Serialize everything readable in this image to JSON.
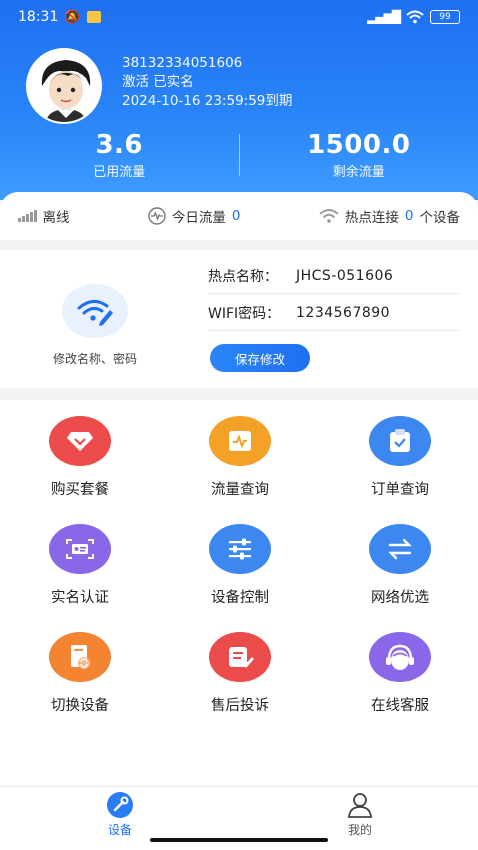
{
  "status_bar": {
    "time": "18:31",
    "battery": "99"
  },
  "profile": {
    "id": "38132334051606",
    "status": "激活  已实名",
    "expiry": "2024-10-16 23:59:59到期"
  },
  "stats": [
    {
      "value": "3.6",
      "label": "已用流量"
    },
    {
      "value": "1500.0",
      "label": "剩余流量"
    }
  ],
  "connection": {
    "state": "离线",
    "today_label": "今日流量",
    "today_value": "0",
    "hotspot_prefix": "热点连接",
    "hotspot_count": "0",
    "hotspot_suffix": "个设备"
  },
  "hotspot": {
    "edit_label": "修改名称、密码",
    "name_label": "热点名称：",
    "name_value": "JHCS-051606",
    "password_label": "WIFI密码：",
    "password_value": "1234567890",
    "save_label": "保存修改"
  },
  "menu": [
    {
      "label": "购买套餐",
      "icon": "diamond-icon",
      "color": "#ec4b4b"
    },
    {
      "label": "流量查询",
      "icon": "chart-card-icon",
      "color": "#f4a127"
    },
    {
      "label": "订单查询",
      "icon": "clipboard-icon",
      "color": "#3c87f0"
    },
    {
      "label": "实名认证",
      "icon": "id-card-icon",
      "color": "#8a67e8"
    },
    {
      "label": "设备控制",
      "icon": "sliders-icon",
      "color": "#3c87f0"
    },
    {
      "label": "网络优选",
      "icon": "swap-icon",
      "color": "#3c87f0"
    },
    {
      "label": "切换设备",
      "icon": "switch-device-icon",
      "color": "#f48332"
    },
    {
      "label": "售后投诉",
      "icon": "complaint-icon",
      "color": "#ec4b4b"
    },
    {
      "label": "在线客服",
      "icon": "headset-icon",
      "color": "#8a67e8"
    }
  ],
  "nav": [
    {
      "label": "设备",
      "icon": "wrench-icon",
      "active": true
    },
    {
      "label": "我的",
      "icon": "person-icon",
      "active": false
    }
  ]
}
